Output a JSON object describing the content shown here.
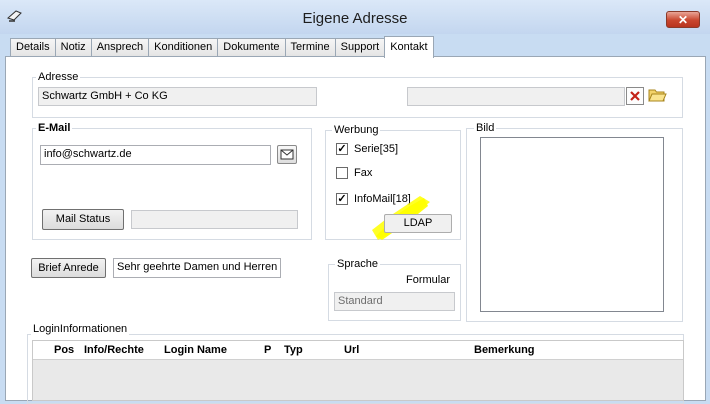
{
  "window": {
    "title": "Eigene Adresse",
    "close_glyph": "✕"
  },
  "tabs": [
    {
      "label": "Details"
    },
    {
      "label": "Notiz"
    },
    {
      "label": "Ansprech"
    },
    {
      "label": "Konditionen"
    },
    {
      "label": "Dokumente"
    },
    {
      "label": "Termine"
    },
    {
      "label": "Support"
    },
    {
      "label": "Kontakt",
      "active": true
    }
  ],
  "adresse": {
    "label": "Adresse",
    "value": "Schwartz GmbH + Co KG",
    "second_value": ""
  },
  "email": {
    "label": "E-Mail",
    "value": "info@schwartz.de",
    "mail_status_button": "Mail Status",
    "status_value": ""
  },
  "werbung": {
    "label": "Werbung",
    "options": [
      {
        "label": "Serie[35]",
        "checked": true
      },
      {
        "label": "Fax",
        "checked": false
      },
      {
        "label": "InfoMail[18]",
        "checked": true
      }
    ],
    "ldap_button": "LDAP"
  },
  "bild": {
    "label": "Bild"
  },
  "brief": {
    "button": "Brief  Anrede",
    "value": "Sehr geehrte Damen und Herren"
  },
  "sprache": {
    "label": "Sprache",
    "formular_label": "Formular",
    "value": "Standard"
  },
  "login": {
    "label": "LoginInformationen",
    "columns": [
      "Pos",
      "Info/Rechte",
      "Login Name",
      "P",
      "Typ",
      "Url",
      "Bemerkung"
    ]
  },
  "colors": {
    "highlight": "#ffff00",
    "title_bg": "#c8dcf2",
    "close_red": "#c9462e"
  }
}
